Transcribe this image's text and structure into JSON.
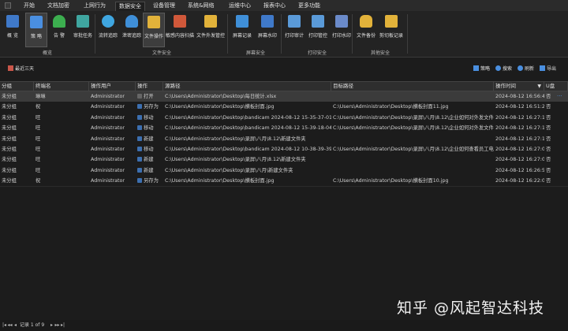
{
  "menubar": {
    "items": [
      {
        "label": "开始"
      },
      {
        "label": "文档加密"
      },
      {
        "label": "上网行为"
      },
      {
        "label": "数据安全"
      },
      {
        "label": "设备管理"
      },
      {
        "label": "系统&网络"
      },
      {
        "label": "运维中心"
      },
      {
        "label": "报表中心"
      },
      {
        "label": "更多功能"
      }
    ],
    "active": "数据安全"
  },
  "ribbon": {
    "groups": [
      {
        "label": "概览"
      },
      {
        "label": "文件安全"
      },
      {
        "label": "屏幕安全"
      },
      {
        "label": "打印安全"
      },
      {
        "label": "其他安全"
      }
    ],
    "buttons": [
      {
        "label": "概 览",
        "icon": "grid-icon",
        "color": "#3f79c9"
      },
      {
        "label": "策 略",
        "icon": "sliders-icon",
        "color": "#4a8fe0"
      },
      {
        "label": "告 警",
        "icon": "bell-icon",
        "color": "#3cae4f"
      },
      {
        "label": "审批任务",
        "icon": "approval-icon",
        "color": "#3fa6a0"
      },
      {
        "label": "流转追踪",
        "icon": "flow-icon",
        "color": "#3fa6e0"
      },
      {
        "label": "泄密追踪",
        "icon": "cloud-icon",
        "color": "#3f8fd8"
      },
      {
        "label": "文件操作",
        "icon": "folder-icon",
        "color": "#e2b23a"
      },
      {
        "label": "敏感内容扫描",
        "icon": "scan-icon",
        "color": "#d0583a"
      },
      {
        "label": "文件外发管控",
        "icon": "folder-send-icon",
        "color": "#e2b23a"
      },
      {
        "label": "屏幕记录",
        "icon": "monitor-icon",
        "color": "#3f8fd8"
      },
      {
        "label": "屏幕水印",
        "icon": "watermark-icon",
        "color": "#3f79c9"
      },
      {
        "label": "打印审计",
        "icon": "printer-icon",
        "color": "#5a9ad8"
      },
      {
        "label": "打印管控",
        "icon": "printer-lock-icon",
        "color": "#5a9ad8"
      },
      {
        "label": "打印水印",
        "icon": "document-icon",
        "color": "#6a8ac9"
      },
      {
        "label": "文件备份",
        "icon": "database-icon",
        "color": "#e2b23a"
      },
      {
        "label": "剪切板记录",
        "icon": "clipboard-icon",
        "color": "#e2b23a"
      }
    ]
  },
  "toolbar": {
    "range_label": "最近三天",
    "strategy_label": "策略",
    "search_label": "搜索",
    "refresh_label": "刷新",
    "export_label": "导出"
  },
  "table": {
    "columns": [
      "分组",
      "终端名",
      "操作用户",
      "操作",
      "源路径",
      "目标路径",
      "操作时间",
      "U盘"
    ],
    "rows": [
      {
        "group": "未分组",
        "terminal": "琳琳",
        "user": "Administrator",
        "op": "打开",
        "src": "C:\\Users\\Administrator\\Desktop\\每日统计.xlsx",
        "dst": "",
        "time": "2024-08-12 16:56:45",
        "usb": "否",
        "op_color": "#666666",
        "selected": true
      },
      {
        "group": "未分组",
        "terminal": "祝",
        "user": "Administrator",
        "op": "另存为",
        "src": "C:\\Users\\Administrator\\Desktop\\横板封面.jpg",
        "dst": "C:\\Users\\Administrator\\Desktop\\横板封面11.jpg",
        "time": "2024-08-12 16:51:21",
        "usb": "否",
        "op_color": "#3c6fb0"
      },
      {
        "group": "未分组",
        "terminal": "旺",
        "user": "Administrator",
        "op": "移动",
        "src": "C:\\Users\\Administrator\\Desktop\\bandicam 2024-08-12 15-35-37-017...",
        "dst": "C:\\Users\\Administrator\\Desktop\\录屏\\八月\\8.12\\企业如何对外发文件进...",
        "time": "2024-08-12 16:27:14",
        "usb": "否",
        "op_color": "#3c6fb0"
      },
      {
        "group": "未分组",
        "terminal": "旺",
        "user": "Administrator",
        "op": "移动",
        "src": "C:\\Users\\Administrator\\Desktop\\bandicam 2024-08-12 15-39-18-045...",
        "dst": "C:\\Users\\Administrator\\Desktop\\录屏\\八月\\8.12\\企业如何对外发文件进...",
        "time": "2024-08-12 16:27:14",
        "usb": "否",
        "op_color": "#3c6fb0"
      },
      {
        "group": "未分组",
        "terminal": "旺",
        "user": "Administrator",
        "op": "新建",
        "src": "C:\\Users\\Administrator\\Desktop\\录屏\\八月\\8.12\\新建文件夹",
        "dst": "",
        "time": "2024-08-12 16:27:11",
        "usb": "否",
        "op_color": "#3c6fb0"
      },
      {
        "group": "未分组",
        "terminal": "旺",
        "user": "Administrator",
        "op": "移动",
        "src": "C:\\Users\\Administrator\\Desktop\\bandicam 2024-08-12 10-38-39-397...",
        "dst": "C:\\Users\\Administrator\\Desktop\\录屏\\八月\\8.12\\企业如何查看员工电脑...",
        "time": "2024-08-12 16:27:06",
        "usb": "否",
        "op_color": "#3c6fb0"
      },
      {
        "group": "未分组",
        "terminal": "旺",
        "user": "Administrator",
        "op": "新建",
        "src": "C:\\Users\\Administrator\\Desktop\\录屏\\八月\\8.12\\新建文件夹",
        "dst": "",
        "time": "2024-08-12 16:27:01",
        "usb": "否",
        "op_color": "#3c6fb0"
      },
      {
        "group": "未分组",
        "terminal": "旺",
        "user": "Administrator",
        "op": "新建",
        "src": "C:\\Users\\Administrator\\Desktop\\录屏\\八月\\新建文件夹",
        "dst": "",
        "time": "2024-08-12 16:26:56",
        "usb": "否",
        "op_color": "#3c6fb0"
      },
      {
        "group": "未分组",
        "terminal": "祝",
        "user": "Administrator",
        "op": "另存为",
        "src": "C:\\Users\\Administrator\\Desktop\\横板封面.jpg",
        "dst": "C:\\Users\\Administrator\\Desktop\\横板封面10.jpg",
        "time": "2024-08-12 16:22:02",
        "usb": "否",
        "op_color": "#3c6fb0"
      }
    ]
  },
  "status": {
    "record_text": "记录 1 of 9"
  },
  "watermark": {
    "text": "知乎 @风起智达科技"
  }
}
